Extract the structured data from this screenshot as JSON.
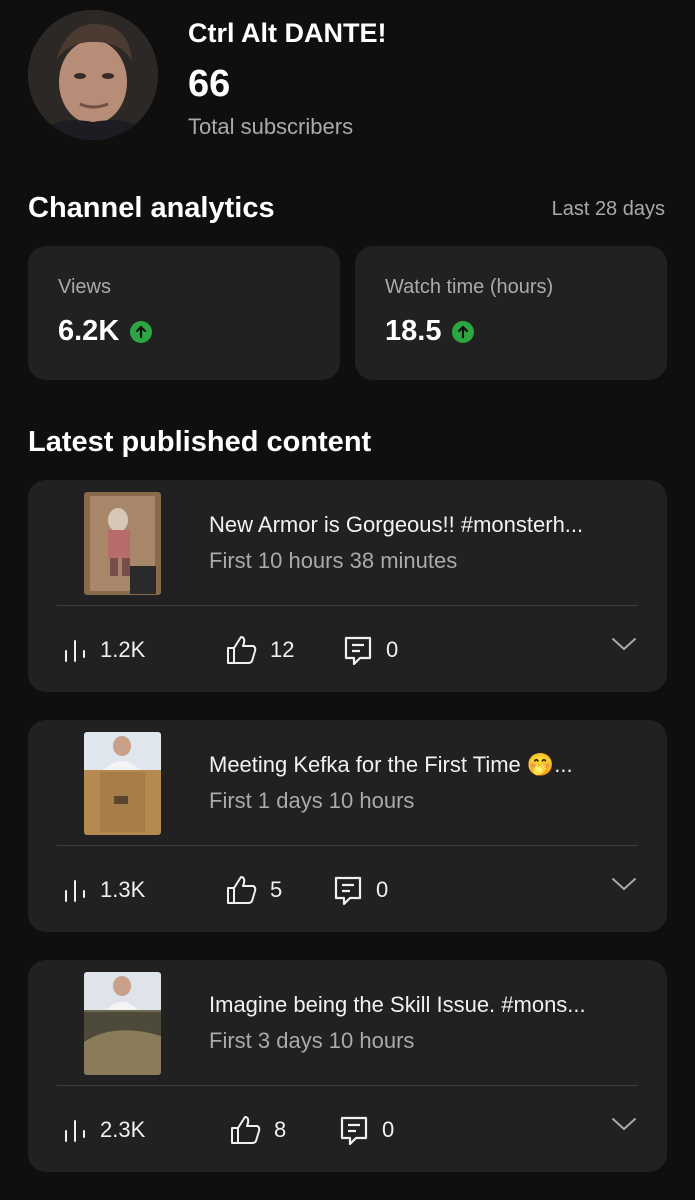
{
  "channel": {
    "name": "Ctrl Alt DANTE!",
    "subscribers": "66",
    "subscribers_label": "Total subscribers"
  },
  "analytics": {
    "title": "Channel analytics",
    "period": "Last 28 days",
    "cards": [
      {
        "label": "Views",
        "value": "6.2K",
        "trend": "up",
        "trend_color": "#2ba640"
      },
      {
        "label": "Watch time (hours)",
        "value": "18.5",
        "trend": "up",
        "trend_color": "#2ba640"
      }
    ]
  },
  "latest": {
    "title": "Latest published content",
    "videos": [
      {
        "title": "New Armor is Gorgeous!! #monsterh...",
        "subtitle": "First 10 hours 38 minutes",
        "views": "1.2K",
        "likes": "12",
        "comments": "0"
      },
      {
        "title": "Meeting Kefka for the First Time 🤭...",
        "subtitle": "First 1 days 10 hours",
        "views": "1.3K",
        "likes": "5",
        "comments": "0"
      },
      {
        "title": "Imagine being the Skill Issue. #mons...",
        "subtitle": "First 3 days 10 hours",
        "views": "2.3K",
        "likes": "8",
        "comments": "0"
      }
    ]
  },
  "icons": {
    "views": "bar-chart-icon",
    "likes": "thumbs-up-icon",
    "comments": "comment-icon",
    "expand": "chevron-down-icon",
    "trend": "arrow-up-icon"
  }
}
